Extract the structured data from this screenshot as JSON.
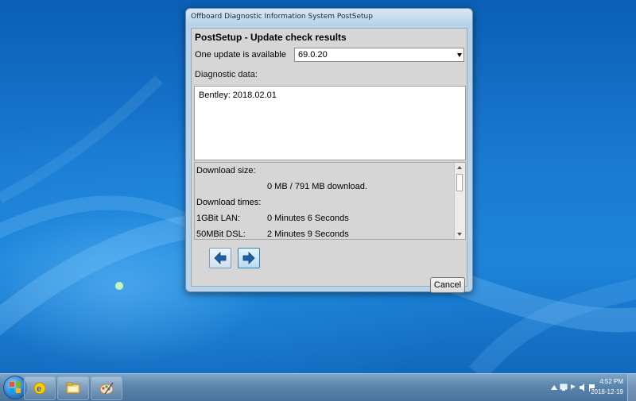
{
  "window": {
    "title": "Offboard Diagnostic Information System PostSetup"
  },
  "dialog": {
    "heading": "PostSetup - Update check results",
    "update_label": "One update is available",
    "version_selected": "69.0.20",
    "diagnostic_label": "Diagnostic data:",
    "diagnostic_text": "Bentley: 2018.02.01",
    "info": {
      "download_size_label": "Download size:",
      "download_size_value": "0 MB / 791 MB download.",
      "download_times_label": "Download times:",
      "lan_label": "1GBit LAN:",
      "lan_value": "0 Minutes 6 Seconds",
      "dsl_label": "50MBit DSL:",
      "dsl_value": "2 Minutes 9 Seconds"
    },
    "cancel_label": "Cancel"
  },
  "taskbar": {
    "time": "4:52 PM",
    "date": "2018-12-19",
    "apps": [
      "ie-icon",
      "folder-icon",
      "paint-icon"
    ]
  },
  "colors": {
    "desktop": "#1673c4",
    "dialog_body": "#d6d6d6",
    "window_frame": "#b9d3ea",
    "arrow": "#1f5fa8"
  }
}
